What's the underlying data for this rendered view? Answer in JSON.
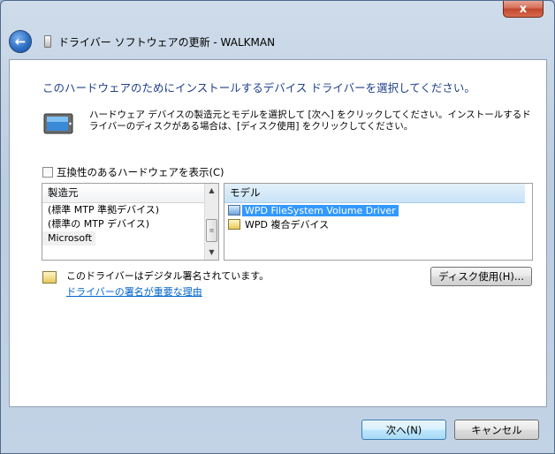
{
  "window": {
    "title": "ドライバー ソフトウェアの更新 - WALKMAN",
    "close_glyph": "x"
  },
  "heading": "このハードウェアのためにインストールするデバイス ドライバーを選択してください。",
  "description": "ハードウェア デバイスの製造元とモデルを選択して [次へ] をクリックしてください。インストールするドライバーのディスクがある場合は、[ディスク使用] をクリックしてください。",
  "compat_checkbox": {
    "label": "互換性のあるハードウェアを表示(C)",
    "checked": false
  },
  "manufacturer_list": {
    "header": "製造元",
    "items": [
      "(標準 MTP 準拠デバイス)",
      "(標準の MTP デバイス)",
      "Microsoft"
    ],
    "selected_index": 2
  },
  "model_list": {
    "header": "モデル",
    "items": [
      "WPD FileSystem Volume Driver",
      "WPD 複合デバイス"
    ],
    "selected_index": 0
  },
  "signature": {
    "text": "このドライバーはデジタル署名されています。",
    "link": "ドライバーの署名が重要な理由"
  },
  "buttons": {
    "disk": "ディスク使用(H)...",
    "next": "次へ(N)",
    "cancel": "キャンセル"
  },
  "icons": {
    "back": "back-arrow-icon",
    "device": "device-monitor-icon",
    "certificate": "certificate-icon"
  },
  "colors": {
    "heading": "#1e3f8a",
    "selection": "#3399ff",
    "link": "#0066cc",
    "close": "#c0472d"
  }
}
